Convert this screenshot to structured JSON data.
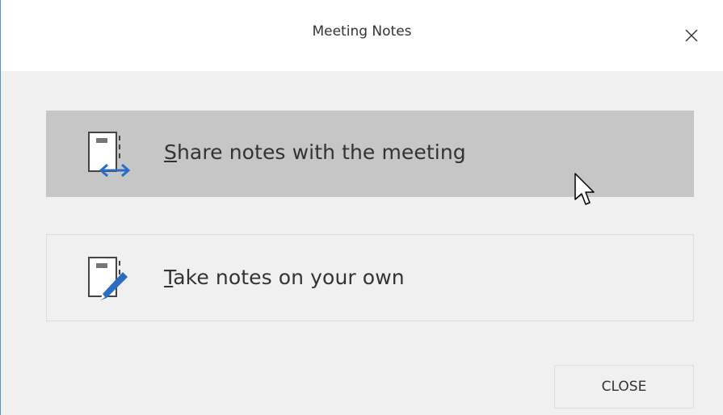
{
  "dialog": {
    "title": "Meeting Notes",
    "close_icon": "close-icon"
  },
  "options": {
    "share": {
      "label": "Share notes with the meeting",
      "icon": "notebook-share-icon",
      "state": "hovered"
    },
    "take": {
      "label": "Take notes on your own",
      "icon": "notebook-edit-icon"
    }
  },
  "footer": {
    "close_label": "CLOSE"
  },
  "colors": {
    "accent": "#2b6cc4",
    "hover_bg": "#c6c6c6",
    "dialog_bg": "#f0f0f0",
    "text": "#333333"
  }
}
